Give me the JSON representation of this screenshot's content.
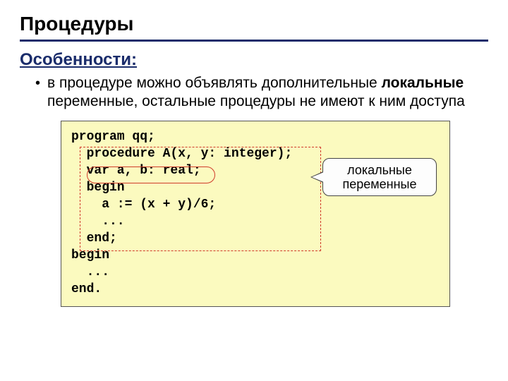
{
  "title": "Процедуры",
  "subtitle": "Особенности:",
  "bullet": {
    "pre": "в процедуре можно объявлять дополнительные ",
    "bold": "локальные",
    "post": " переменные, остальные процедуры не имеют к ним доступа"
  },
  "code": {
    "l1": "program qq;",
    "l2": "  procedure A(x, y: integer);",
    "l3": "  var a, b: real;",
    "l4": "  begin",
    "l5": "    a := (x + y)/6;",
    "l6": "    ...",
    "l7": "  end;",
    "l8": "begin",
    "l9": "  ...",
    "l10": "end."
  },
  "callout": {
    "line1": "локальные",
    "line2": "переменные"
  }
}
